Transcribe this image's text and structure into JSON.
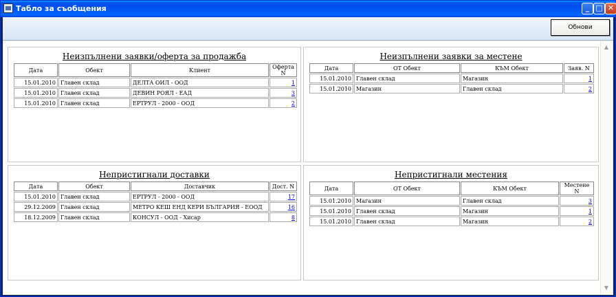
{
  "window": {
    "title": "Табло за съобщения"
  },
  "toolbar": {
    "refresh_label": "Обнови"
  },
  "icons": {
    "app": "app-icon",
    "minimize": "minimize-icon",
    "maximize": "maximize-icon",
    "close": "close-icon",
    "scroll_up": "chevron-up-icon",
    "scroll_down": "chevron-down-icon"
  },
  "panels": [
    {
      "title": "Неизпълнени заявки/оферта за продажба",
      "headers": [
        "Дата",
        "Обект",
        "Клиент",
        "Оферта N"
      ],
      "rows": [
        [
          "15.01.2010",
          "Главен склад",
          "ДЕЛТА ОИЛ - ООД",
          "1"
        ],
        [
          "15.01.2010",
          "Главен склад",
          "ДЕВИН РОЯЛ - ЕАД",
          "3"
        ],
        [
          "15.01.2010",
          "Главен склад",
          "ЕРТРУЛ - 2000 - ООД",
          "2"
        ]
      ]
    },
    {
      "title": "Неизпълнени заявки за местене",
      "headers": [
        "Дата",
        "ОТ Обект",
        "КЪМ Обект",
        "Заяв. N"
      ],
      "rows": [
        [
          "15.01.2010",
          "Главен склад",
          "Магазин",
          "1"
        ],
        [
          "15.01.2010",
          "Магазин",
          "Главен склад",
          "2"
        ]
      ]
    },
    {
      "title": "Непристигнали доставки",
      "headers": [
        "Дата",
        "Обект",
        "Доставчик",
        "Дост. N"
      ],
      "rows": [
        [
          "15.01.2010",
          "Главен склад",
          "ЕРТРУЛ - 2000 - ООД",
          "17"
        ],
        [
          "29.12.2009",
          "Главен склад",
          "МЕТРО КЕШ ЕНД КЕРИ БЪЛГАРИЯ - ЕООД",
          "16"
        ],
        [
          "18.12.2009",
          "Главен склад",
          "КОНСУЛ - ООД - Хисар",
          "8"
        ]
      ]
    },
    {
      "title": "Непристигнали местения",
      "headers": [
        "Дата",
        "ОТ Обект",
        "КЪМ Обект",
        "Местене N"
      ],
      "rows": [
        [
          "15.01.2010",
          "Магазин",
          "Главен склад",
          "3"
        ],
        [
          "15.01.2010",
          "Главен склад",
          "Магазин",
          "1"
        ],
        [
          "15.01.2010",
          "Главен склад",
          "Магазин",
          "2"
        ]
      ]
    }
  ]
}
